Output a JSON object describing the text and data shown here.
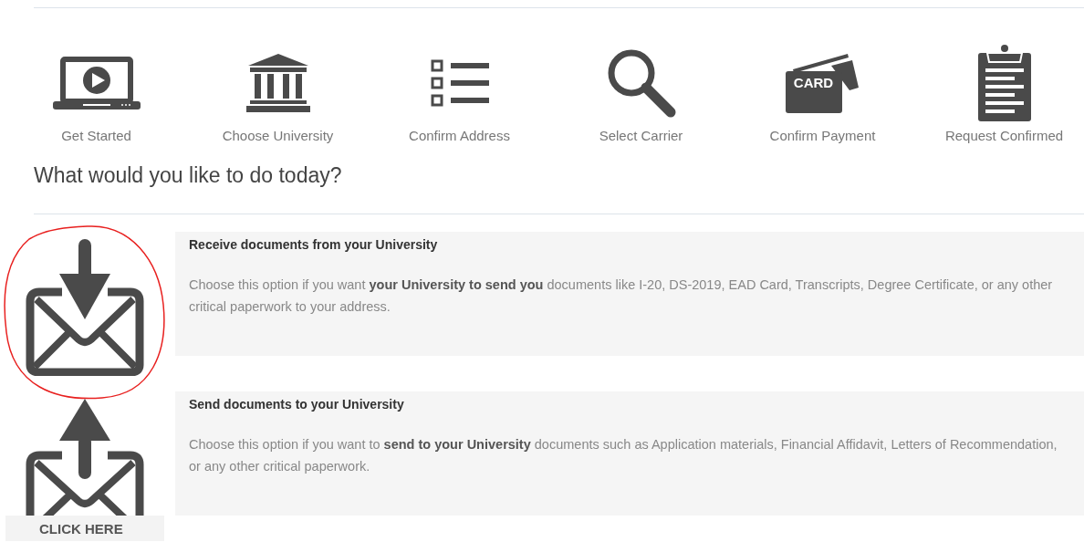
{
  "steps": [
    {
      "kind": "laptop",
      "label": "Get Started"
    },
    {
      "kind": "bank",
      "label": "Choose University"
    },
    {
      "kind": "list",
      "label": "Confirm Address"
    },
    {
      "kind": "magnifier",
      "label": "Select Carrier"
    },
    {
      "kind": "card",
      "label": "Confirm Payment",
      "badge": "CARD"
    },
    {
      "kind": "clipboard",
      "label": "Request Confirmed"
    }
  ],
  "heading": "What would you like to do today?",
  "options": [
    {
      "kind": "receive",
      "title": "Receive documents from your University",
      "description": "Choose this option if you want **your University to send you** documents like I-20, DS-2019, EAD Card, Transcripts, Degree Certificate, or any other critical paperwork to your address.",
      "circled": true
    },
    {
      "kind": "send",
      "title": "Send documents to your University",
      "description": "Choose this option if you want to **send to your University** documents such as Application materials, Financial Affidavit, Letters of Recommendation, or any other critical paperwork.",
      "circled": false
    }
  ],
  "click_here": "CLICK HERE"
}
